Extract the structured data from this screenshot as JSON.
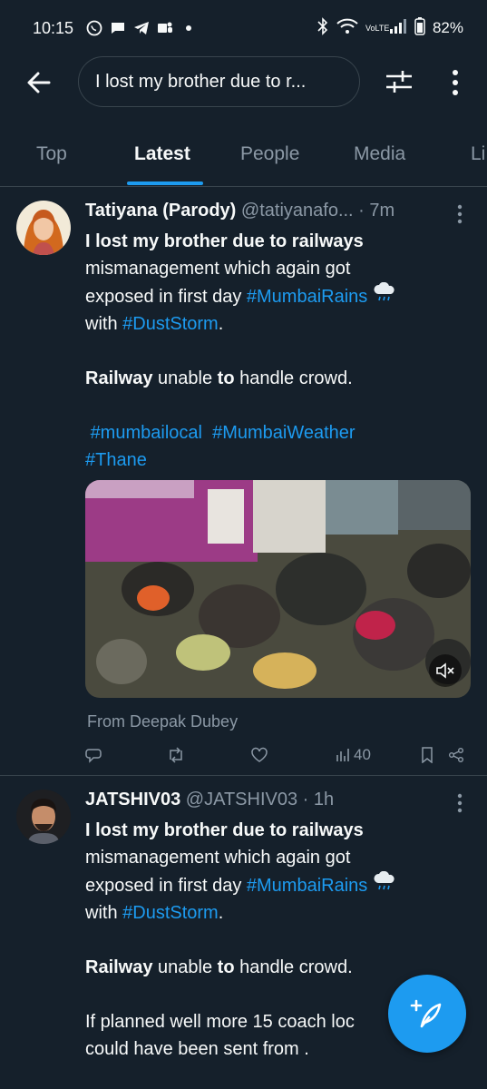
{
  "status_bar": {
    "time": "10:15",
    "battery": "82%",
    "network": "VoLTE"
  },
  "search": {
    "query": "I lost my brother due to r..."
  },
  "tabs": [
    {
      "label": "Top",
      "active": false
    },
    {
      "label": "Latest",
      "active": true
    },
    {
      "label": "People",
      "active": false
    },
    {
      "label": "Media",
      "active": false
    },
    {
      "label": "Li",
      "active": false
    }
  ],
  "tweets": [
    {
      "name": "Tatiyana (Parody)",
      "handle": "@tatiyanafo...",
      "time": "· 7m",
      "bold_line": "I lost my brother due to railways",
      "line2": "mismanagement which again got",
      "line3_pre": "exposed in first day ",
      "tag1": "#MumbaiRains",
      "line4_pre": "with ",
      "tag2": "#DustStorm",
      "line4_post": ".",
      "railway_word": "Railway",
      "railway_mid": " unable ",
      "railway_to": "to",
      "railway_post": " handle crowd.",
      "tags_line1_a": "#mumbailocal",
      "tags_line1_b": "#MumbaiWeather",
      "tags_line2": "#Thane",
      "from": "From Deepak Dubey",
      "views": "40"
    },
    {
      "name": "JATSHIV03",
      "handle": "@JATSHIV03",
      "time": "· 1h",
      "bold_line": "I lost my brother due to railways",
      "line2": "mismanagement which again got",
      "line3_pre": "exposed in first day ",
      "tag1": "#MumbaiRains",
      "line4_pre": "with ",
      "tag2": "#DustStorm",
      "line4_post": ".",
      "railway_word": "Railway",
      "railway_mid": " unable ",
      "railway_to": "to",
      "railway_post": " handle crowd.",
      "line_extra1": "If planned well more 15 coach loc",
      "line_extra2": "could have been sent from ."
    }
  ],
  "colors": {
    "background": "#15202b",
    "accent": "#1d9bf0",
    "muted": "#8b98a5",
    "divider": "#38444d"
  }
}
